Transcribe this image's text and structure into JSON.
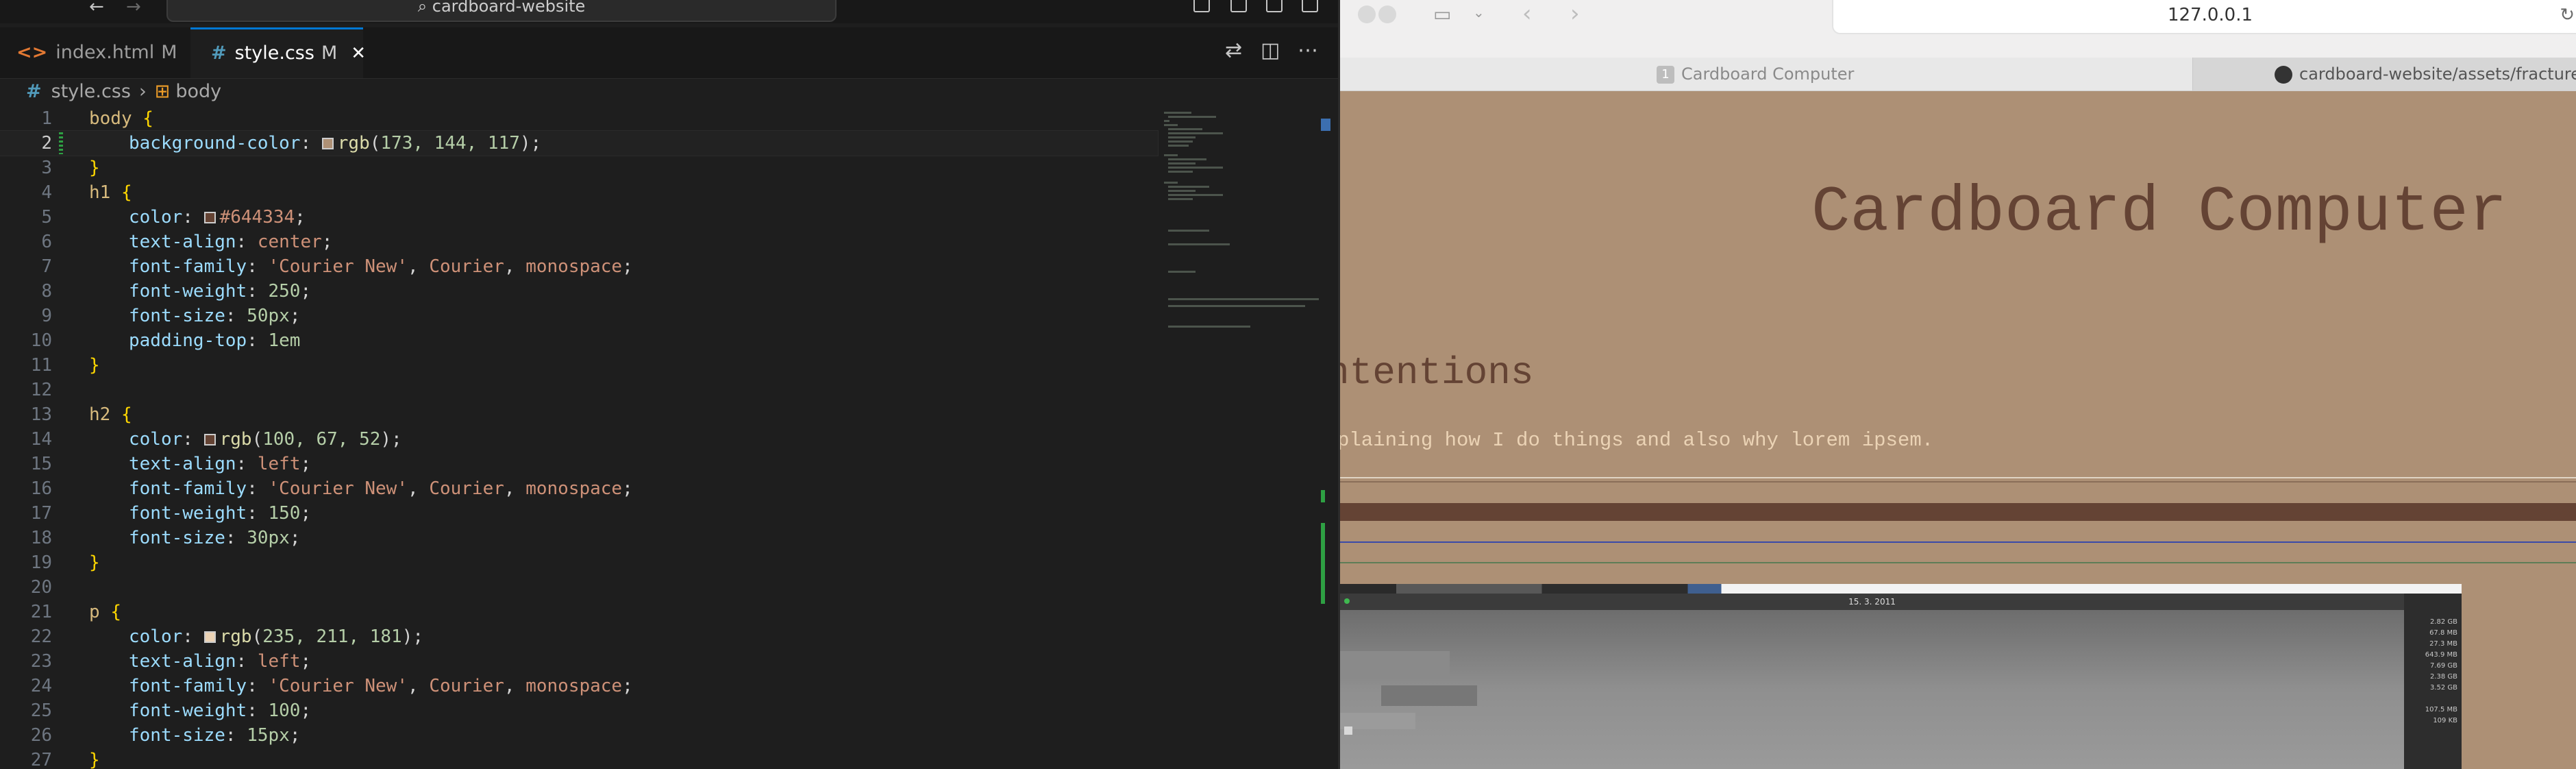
{
  "editor": {
    "search_text": "cardboard-website",
    "tabs": [
      {
        "name": "index.html",
        "status": "M",
        "icon": "<>"
      },
      {
        "name": "style.css",
        "status": "M",
        "icon": "#"
      }
    ],
    "breadcrumb": {
      "file": "style.css",
      "symbol": "body"
    },
    "line_numbers": [
      "1",
      "2",
      "3",
      "4",
      "5",
      "6",
      "7",
      "8",
      "9",
      "10",
      "11",
      "12",
      "13",
      "14",
      "15",
      "16",
      "17",
      "18",
      "19",
      "20",
      "21",
      "22",
      "23",
      "24",
      "25",
      "26",
      "27"
    ],
    "code": {
      "body_sel": "body",
      "h1_sel": "h1",
      "h2_sel": "h2",
      "p_sel": "p",
      "open": "{",
      "close": "}",
      "p_background_color": "background-color",
      "p_color": "color",
      "p_text_align": "text-align",
      "p_font_family": "font-family",
      "p_font_weight": "font-weight",
      "p_font_size": "font-size",
      "p_padding_top": "padding-top",
      "rgb": "rgb",
      "body_bg_args_a": "173, 144, 117",
      "h1_color": "#644334",
      "center": "center",
      "left": "left",
      "courier_str": "'Courier New'",
      "courier": "Courier",
      "monospace": "monospace",
      "w250": "250",
      "s50": "50px",
      "pt1em": "1em",
      "h2_color_args": "100, 67, 52",
      "w150": "150",
      "s30": "30px",
      "p_color_args": "235, 211, 181",
      "w100": "100",
      "s15": "15px"
    },
    "swatch_colors": {
      "body_bg": "#ad9075",
      "h1": "#644334",
      "h2": "#644334",
      "p": "#ebd3b5"
    }
  },
  "browser": {
    "url": "127.0.0.1",
    "tabs": [
      {
        "label": "Cardboard Computer",
        "badge": "1"
      },
      {
        "label": "cardboard-website/assets/fractured-s"
      }
    ],
    "page": {
      "h1": "Cardboard Computer",
      "h2": "ntentions",
      "p": "plaining how I do things and also why lorem ipsem."
    },
    "embedded": {
      "title": "15. 3. 2011",
      "sizes": [
        "2.82 GB",
        "67.8 MB",
        "27.3 MB",
        "643.9 MB",
        "7.69 GB",
        "2.38 GB",
        "3.52 GB",
        "",
        "107.5 MB",
        "109 KB"
      ]
    }
  },
  "colors": {
    "page_bg": "#ad9075",
    "heading": "#644334",
    "para": "#ebd3b5",
    "accent": "#0078d4"
  }
}
